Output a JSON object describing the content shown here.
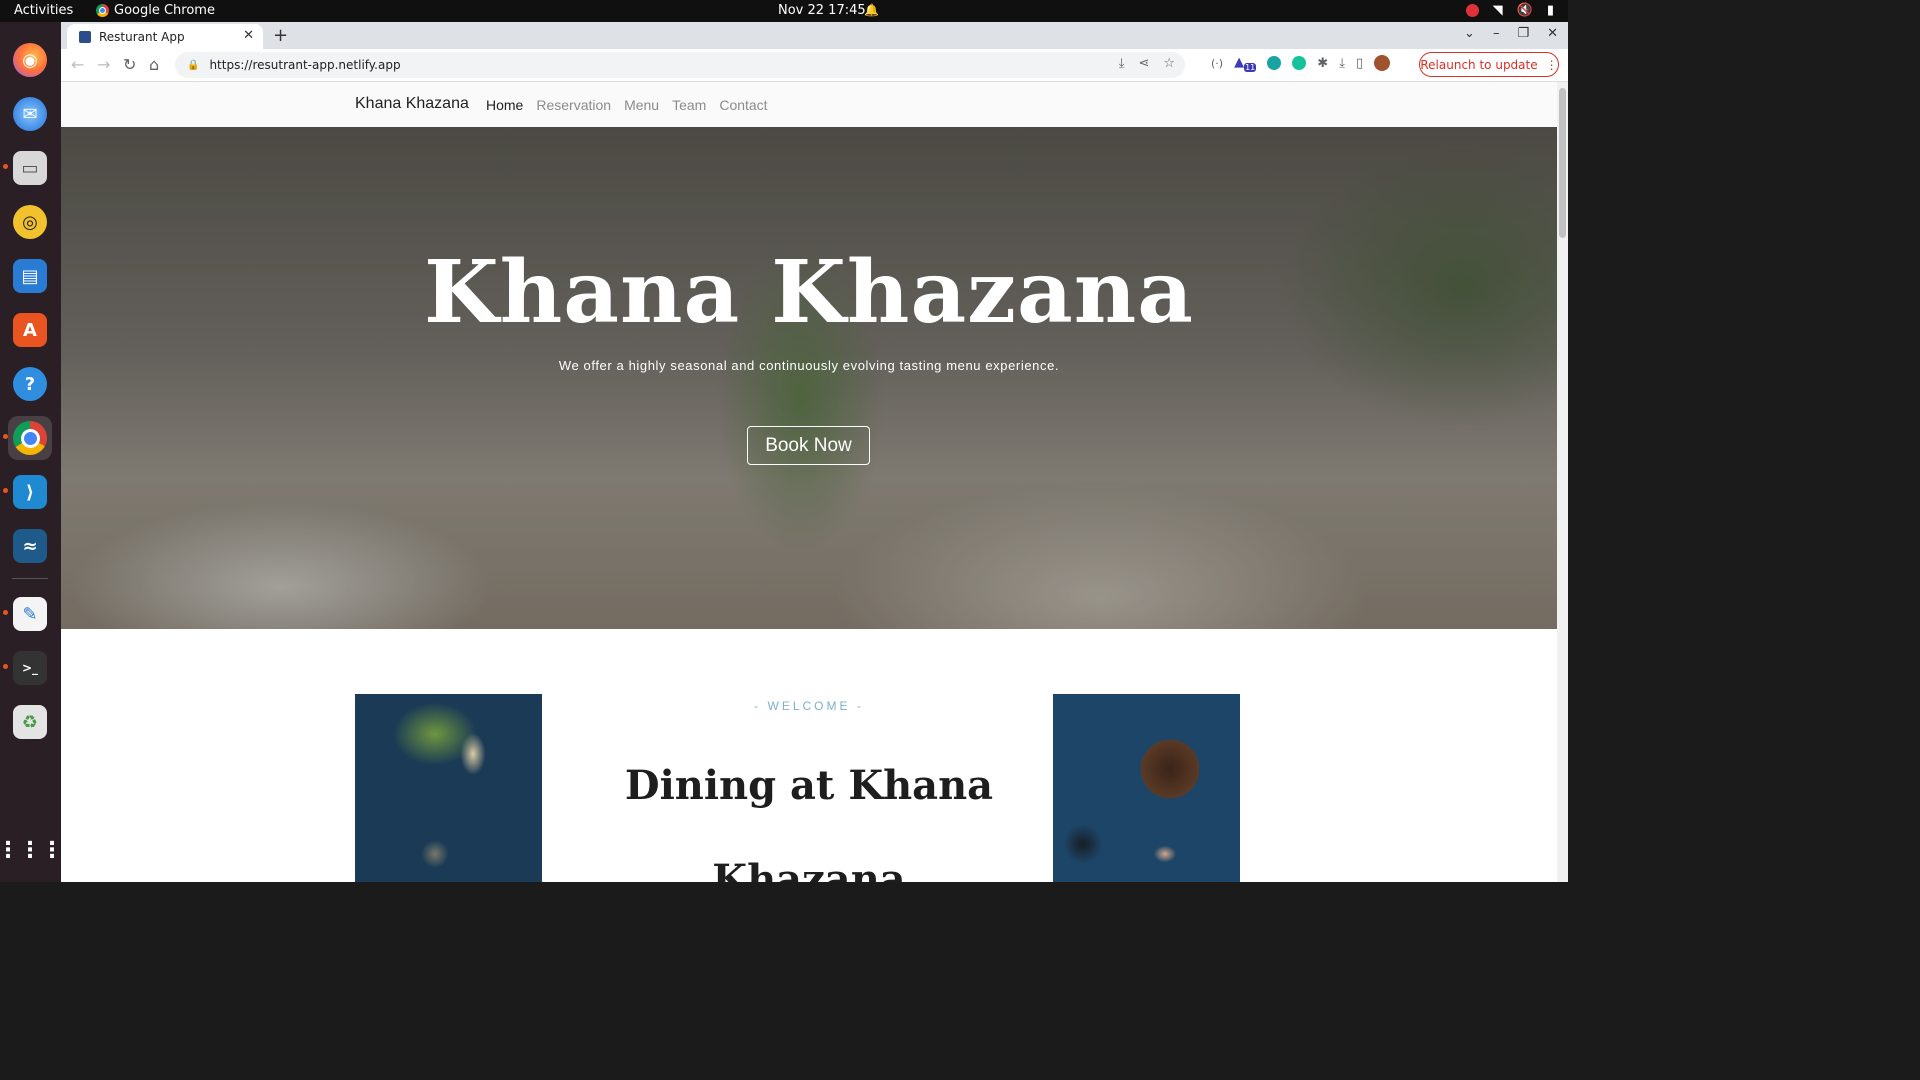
{
  "system_bar": {
    "activities": "Activities",
    "app_name": "Google Chrome",
    "clock": "Nov 22  17:45"
  },
  "dock": {
    "apps": [
      "firefox-icon",
      "thunderbird-icon",
      "files-icon",
      "rhythmbox-icon",
      "writer-icon",
      "software-icon",
      "help-icon",
      "chrome-icon",
      "vscode-icon",
      "mysql-workbench-icon",
      "text-editor-icon",
      "terminal-icon",
      "trash-icon",
      "app-grid-icon"
    ]
  },
  "browser": {
    "tab_title": "Resturant App",
    "url": "https://resutrant-app.netlify.app",
    "relaunch_label": "Relaunch to update",
    "extension_badge": "11"
  },
  "site": {
    "brand": "Khana Khazana",
    "nav": [
      {
        "label": "Home",
        "active": true
      },
      {
        "label": "Reservation",
        "active": false
      },
      {
        "label": "Menu",
        "active": false
      },
      {
        "label": "Team",
        "active": false
      },
      {
        "label": "Contact",
        "active": false
      }
    ],
    "hero": {
      "title": "Khana Khazana",
      "subtitle": "We offer a highly seasonal and continuously evolving tasting menu experience.",
      "cta": "Book Now"
    },
    "welcome": {
      "label": "- WELCOME -",
      "title": "Dining at Khana Khazana"
    }
  },
  "colors": {
    "accent_label": "#7fb0cc",
    "relaunch": "#d93025"
  }
}
